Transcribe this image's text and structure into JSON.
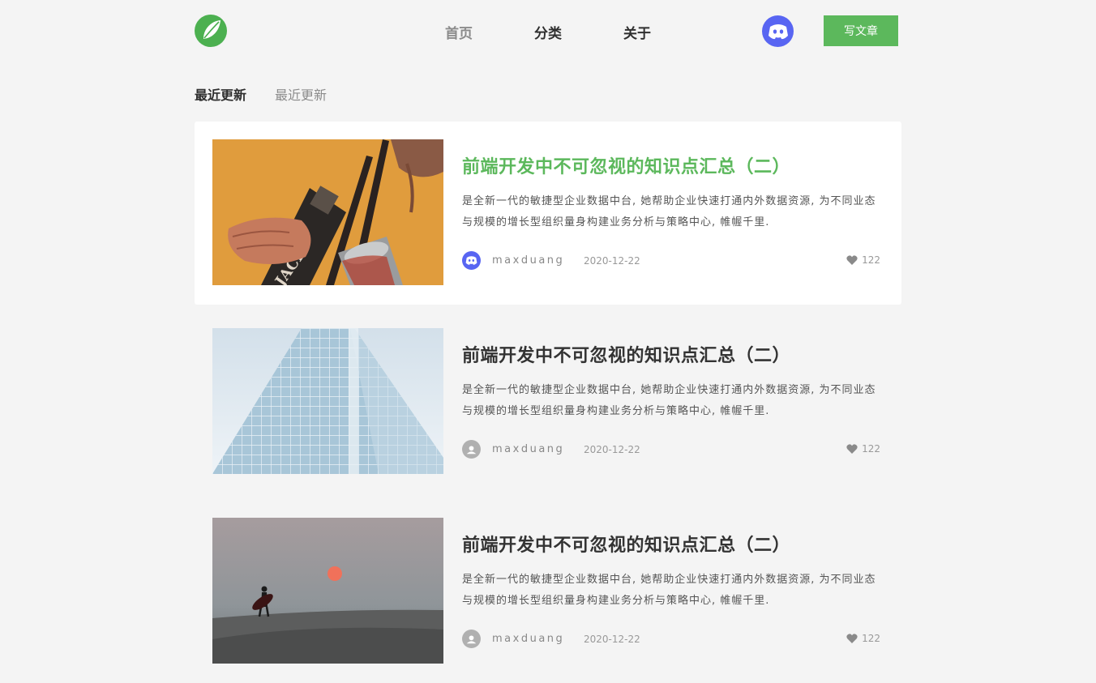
{
  "header": {
    "logo_icon": "leaf-logo-icon",
    "nav": [
      "首页",
      "分类",
      "关于"
    ],
    "avatar_icon": "discord-avatar-icon",
    "write_button": "写文章"
  },
  "tabs": {
    "active": "最近更新",
    "inactive": "最近更新"
  },
  "articles": [
    {
      "title": "前端开发中不可忽视的知识点汇总（二）",
      "desc": "是全新一代的敏捷型企业数据中台, 她帮助企业快速打通内外数据资源, 为不同业态与规模的增长型组织量身构建业务分析与策略中心, 帷幄千里.",
      "author": "maxduang",
      "date": "2020-12-22",
      "likes": "122",
      "thumb": "bottle-pour-image",
      "highlight": true
    },
    {
      "title": "前端开发中不可忽视的知识点汇总（二）",
      "desc": "是全新一代的敏捷型企业数据中台, 她帮助企业快速打通内外数据资源, 为不同业态与规模的增长型组织量身构建业务分析与策略中心, 帷幄千里.",
      "author": "maxduang",
      "date": "2020-12-22",
      "likes": "122",
      "thumb": "glass-building-image",
      "highlight": false
    },
    {
      "title": "前端开发中不可忽视的知识点汇总（二）",
      "desc": "是全新一代的敏捷型企业数据中台, 她帮助企业快速打通内外数据资源, 为不同业态与规模的增长型组织量身构建业务分析与策略中心, 帷幄千里.",
      "author": "maxduang",
      "date": "2020-12-22",
      "likes": "122",
      "thumb": "desert-sunset-image",
      "highlight": false
    }
  ],
  "colors": {
    "accent": "#5cb85c",
    "avatar": "#5865f2",
    "background": "#f4f4f4"
  }
}
